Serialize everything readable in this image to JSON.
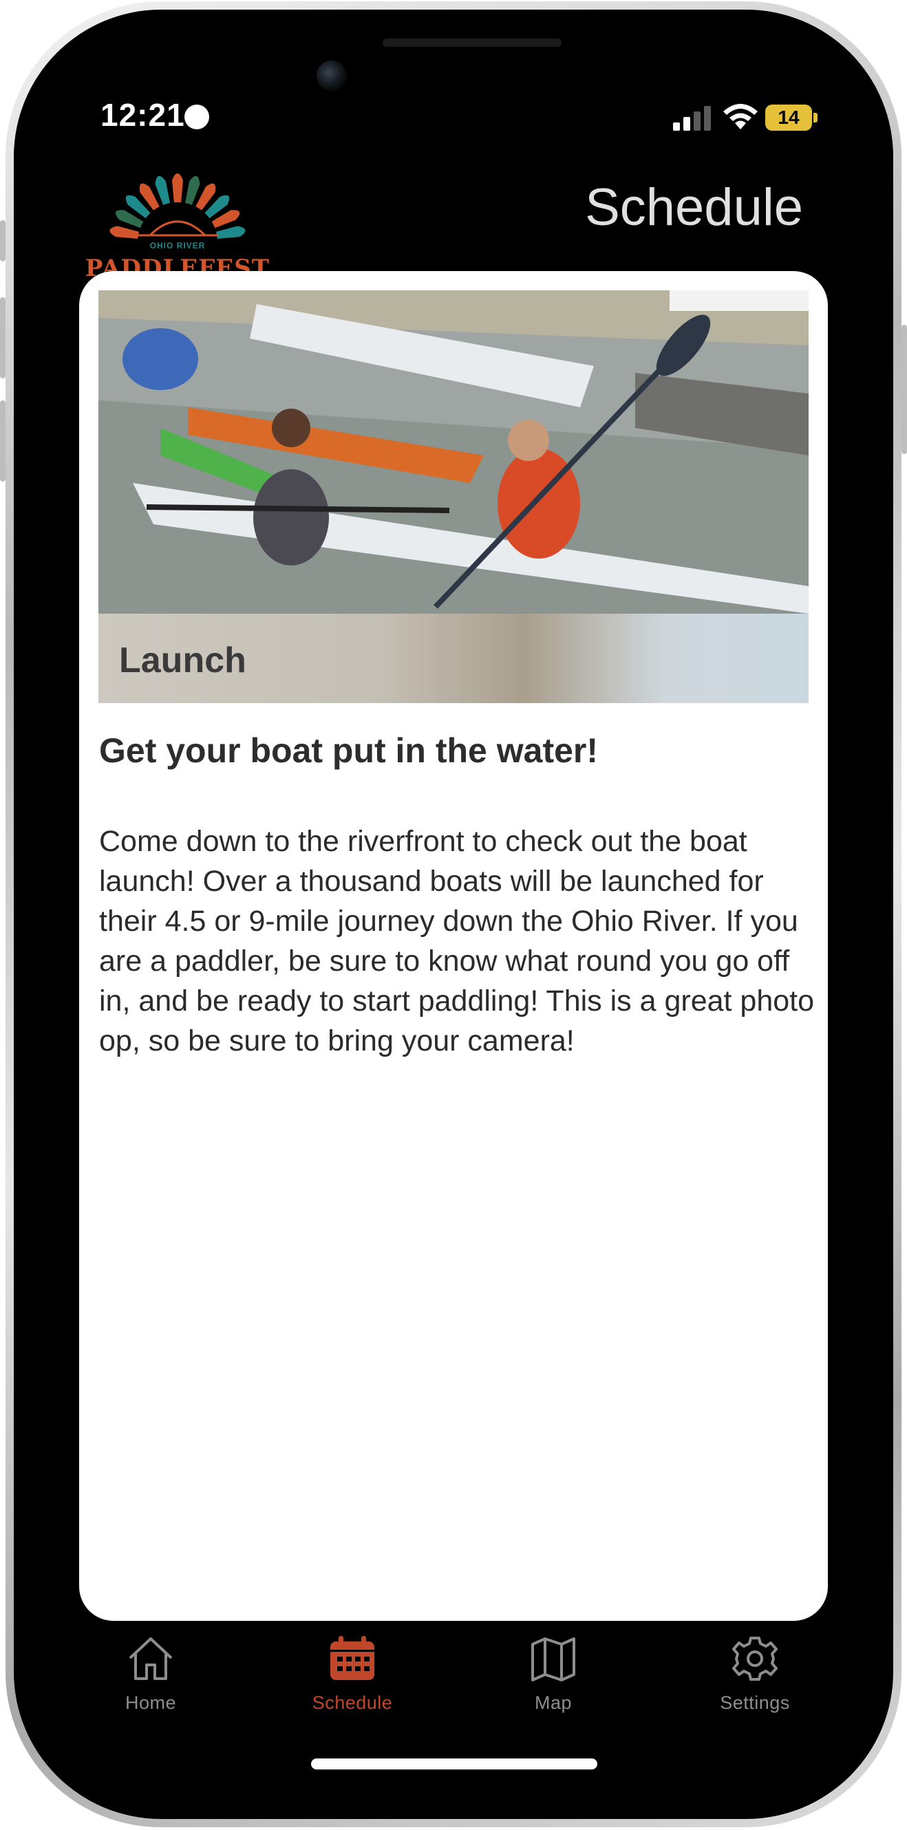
{
  "status_bar": {
    "time": "12:21",
    "battery_level": "14"
  },
  "header": {
    "logo_text": "PADDLEFEST",
    "logo_subtext": "OHIO RIVER",
    "title": "Schedule"
  },
  "event": {
    "image_label": "Launch",
    "subtitle": "Get your boat put in the water!",
    "description": "Come down to the riverfront to check out the boat launch! Over a thousand boats will be launched for their 4.5 or 9-mile journey down the Ohio River. If you are a paddler, be sure to know what round you go off in, and be ready to start paddling! This is a great photo op, so be sure to bring your camera!"
  },
  "tabbar": {
    "items": [
      {
        "label": "Home",
        "icon": "house-icon",
        "active": false
      },
      {
        "label": "Schedule",
        "icon": "calendar-icon",
        "active": true
      },
      {
        "label": "Map",
        "icon": "map-icon",
        "active": false
      },
      {
        "label": "Settings",
        "icon": "gear-icon",
        "active": false
      }
    ]
  },
  "colors": {
    "accent": "#c0472a",
    "inactive_tab": "#8e8e8e",
    "header_text": "#e0e0e0"
  }
}
